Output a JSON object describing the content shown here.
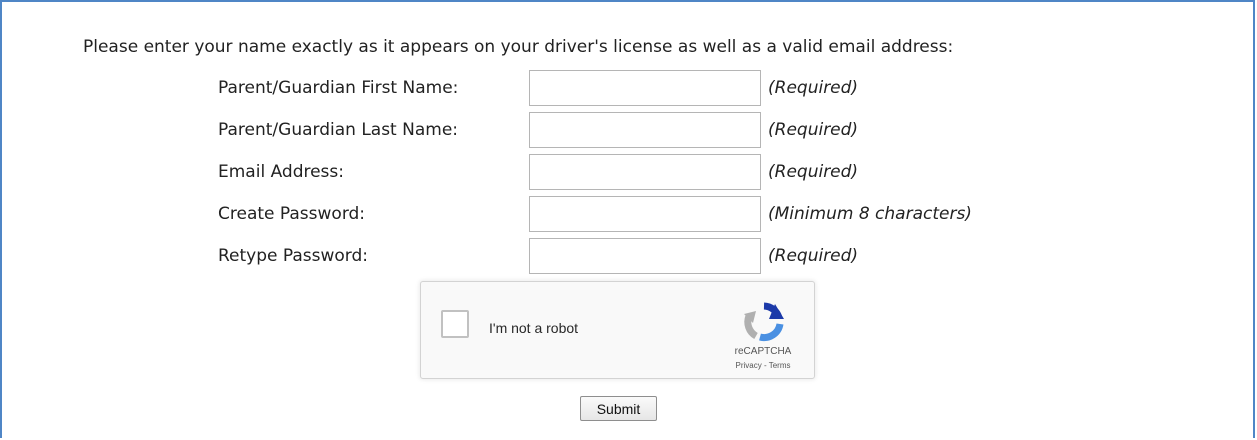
{
  "intro_text": "Please enter your name exactly as it appears on your driver's license as well as a valid email address:",
  "fields": [
    {
      "label": "Parent/Guardian First Name:",
      "value": "",
      "note": "(Required)"
    },
    {
      "label": "Parent/Guardian Last Name:",
      "value": "",
      "note": "(Required)"
    },
    {
      "label": "Email Address:",
      "value": "",
      "note": "(Required)"
    },
    {
      "label": "Create Password:",
      "value": "",
      "note": "(Minimum 8 characters)"
    },
    {
      "label": "Retype Password:",
      "value": "",
      "note": "(Required)"
    }
  ],
  "captcha": {
    "label": "I'm not a robot",
    "brand": "reCAPTCHA",
    "privacy": "Privacy",
    "separator": " - ",
    "terms": "Terms",
    "checked": false,
    "icon": "recaptcha-logo-icon"
  },
  "submit_label": "Submit",
  "colors": {
    "frame_border": "#4f86c6",
    "recaptcha_blue": "#4a90e2",
    "recaptcha_dark_blue": "#1c3aa9",
    "recaptcha_gray": "#b0b0b0"
  }
}
